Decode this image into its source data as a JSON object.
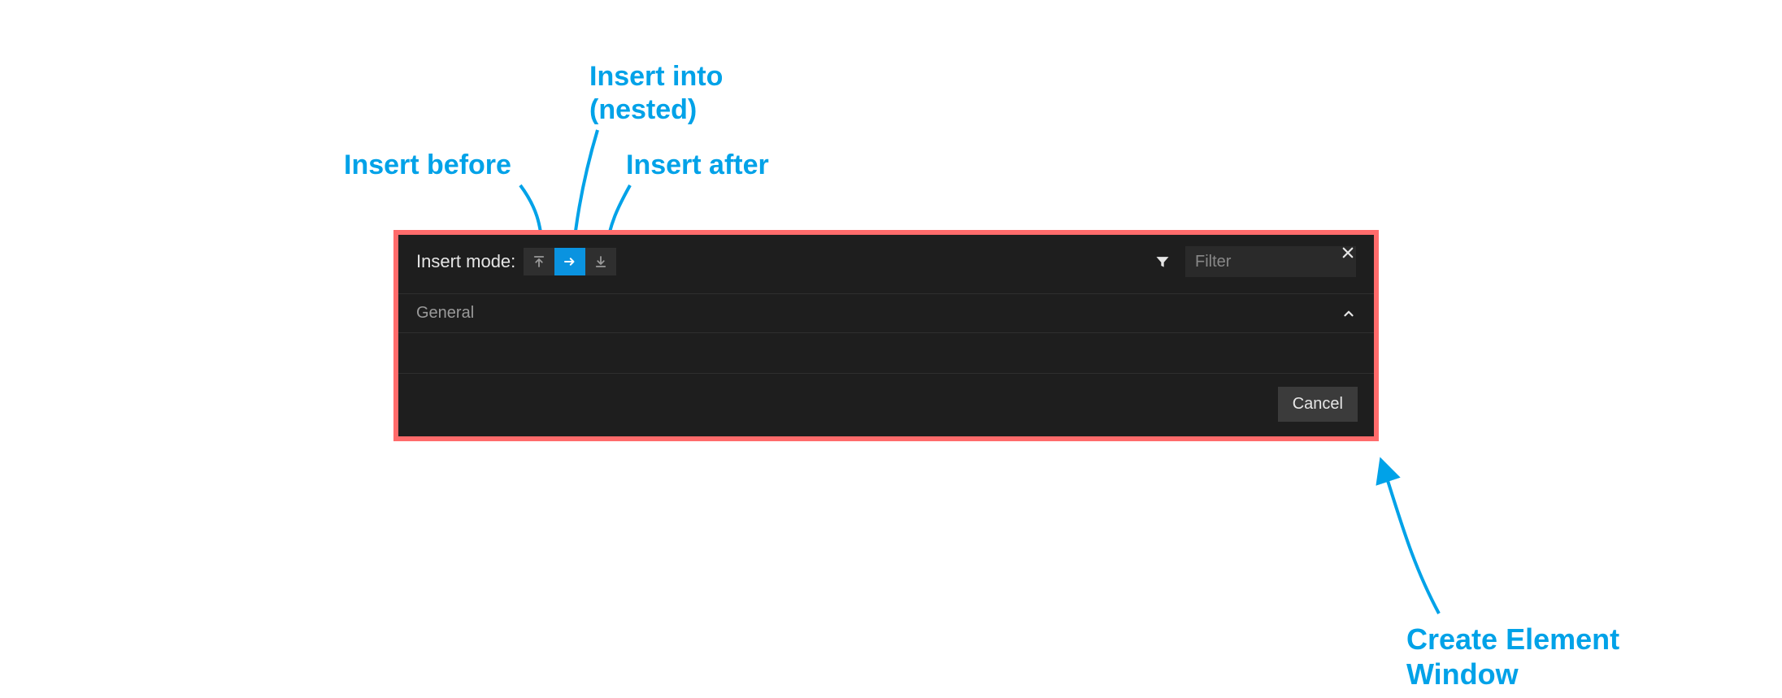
{
  "annotations": {
    "insert_into": "Insert into\n(nested)",
    "insert_before": "Insert before",
    "insert_after": "Insert after",
    "create_element_window": "Create Element\nWindow"
  },
  "window": {
    "insert_mode_label": "Insert mode:",
    "filter_placeholder": "Filter",
    "section_general": "General",
    "cancel_label": "Cancel",
    "icons": {
      "before": "insert-before-icon",
      "into": "insert-into-icon",
      "after": "insert-after-icon",
      "filter": "filter-icon",
      "close": "close-icon",
      "chevron_up": "chevron-up-icon"
    },
    "colors": {
      "accent": "#0a93e0",
      "panel_bg": "#1e1e1e",
      "outline": "#ff6b6b",
      "annotation": "#00a2e8"
    }
  }
}
